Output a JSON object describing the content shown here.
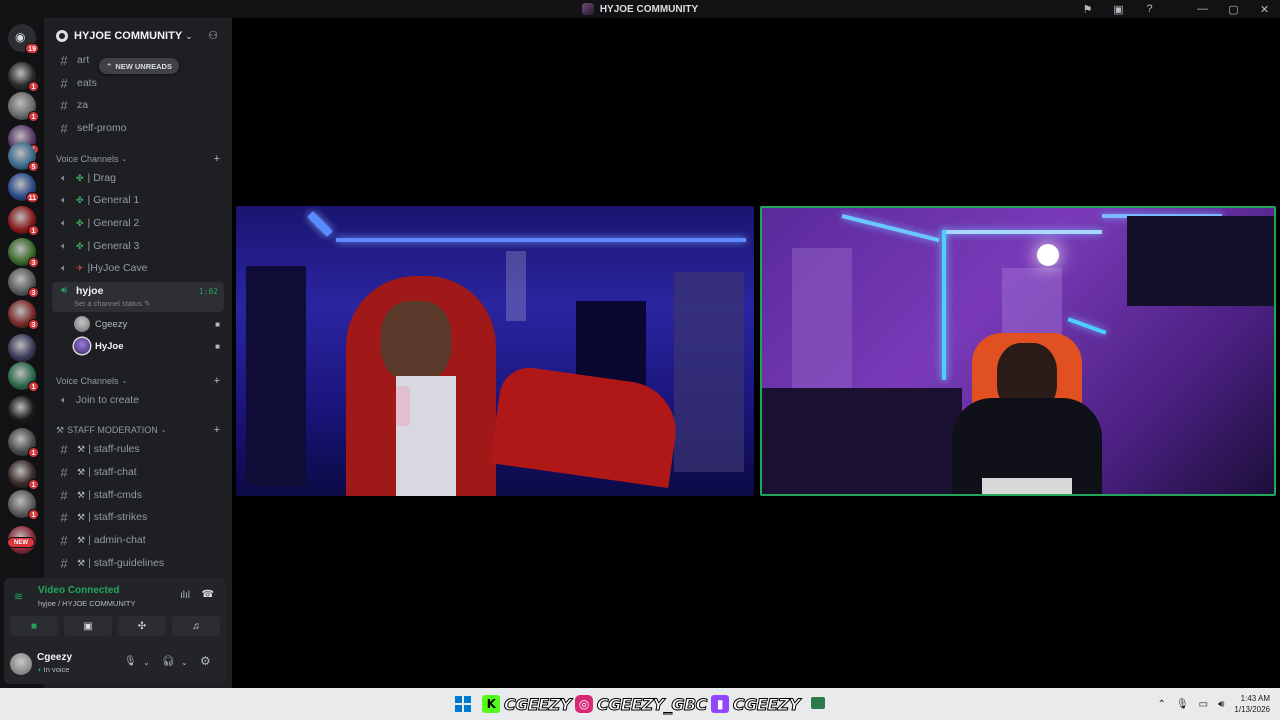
{
  "window": {
    "title": "HYJOE COMMUNITY",
    "controls": [
      "flag-icon",
      "inbox-icon",
      "help-icon",
      "minimize-icon",
      "maximize-icon",
      "close-icon"
    ]
  },
  "server_rail": {
    "home_badge": "19",
    "servers": [
      {
        "badge": "1",
        "color": "#2a2a2a"
      },
      {
        "badge": "1",
        "color": "#6a6a6a"
      },
      {
        "badge": "1",
        "color": "#5a3a6a"
      },
      {
        "badge": "5",
        "color": "#3a6a8a"
      },
      {
        "badge": "11",
        "color": "#2a4a8a"
      },
      {
        "badge": "1",
        "color": "#8a1a1a"
      },
      {
        "badge": "3",
        "color": "#3a6a2a"
      },
      {
        "badge": "3",
        "color": "#5a5a5a"
      },
      {
        "badge": "3",
        "color": "#7a2a2a"
      },
      {
        "badge": "",
        "color": "#3a3a5a"
      },
      {
        "badge": "1",
        "color": "#2a6a4a"
      },
      {
        "badge": "",
        "color": "#1a1a1a"
      },
      {
        "badge": "1",
        "color": "#4a4a4a"
      },
      {
        "badge": "1",
        "color": "#3a2a2a"
      },
      {
        "badge": "1",
        "color": "#5a5a5a"
      },
      {
        "badge": "NEW",
        "color": "#8a2a3a"
      }
    ]
  },
  "guild": {
    "name": "HYJOE COMMUNITY",
    "new_unreads": "NEW UNREADS",
    "text_channels": [
      "art",
      "eats",
      "za",
      "self-promo"
    ],
    "voice_category": "Voice Channels",
    "voice_channels": [
      "| Drag",
      "| General 1",
      "| General 2",
      "| General 3",
      "|HyJoe Cave"
    ],
    "active_channel": {
      "name": "hyjoe",
      "timer": "1:02",
      "status": "Set a channel status"
    },
    "voice_users": [
      {
        "name": "Cgeezy",
        "avatar_color": "#8a8a8a"
      },
      {
        "name": "HyJoe",
        "avatar_color": "#6a4aa8"
      }
    ],
    "voice_category_2": "Voice Channels",
    "join_to_create": "Join to create",
    "staff_category": "STAFF MODERATION",
    "staff_channels": [
      "| staff-rules",
      "|  staff-chat",
      "| staff-cmds",
      "| staff-strikes",
      "| admin-chat",
      "| staff-guidelines"
    ]
  },
  "voice_panel": {
    "status": "Video Connected",
    "location": "hyjoe / HYJOE COMMUNITY"
  },
  "user_panel": {
    "name": "Cgeezy",
    "status": "In voice"
  },
  "video_tiles": [
    {
      "user": "Cgeezy",
      "speaking": false
    },
    {
      "user": "HyJoe",
      "speaking": true
    }
  ],
  "taskbar": {
    "banner_items": [
      {
        "logo": "K",
        "logo_color": "#53fc18",
        "text": "CGEEZY"
      },
      {
        "logo": "◎",
        "logo_color": "#d62976",
        "text": "CGEEZY_GBC"
      },
      {
        "logo": "▮",
        "logo_color": "#9146ff",
        "text": "CGEEZY"
      }
    ],
    "time": "1:43 AM",
    "date": "1/13/2026"
  },
  "colors": {
    "online_green": "#23a559",
    "badge_red": "#da373c",
    "sidebar_bg": "#1e1f22",
    "rail_bg": "#121214"
  }
}
